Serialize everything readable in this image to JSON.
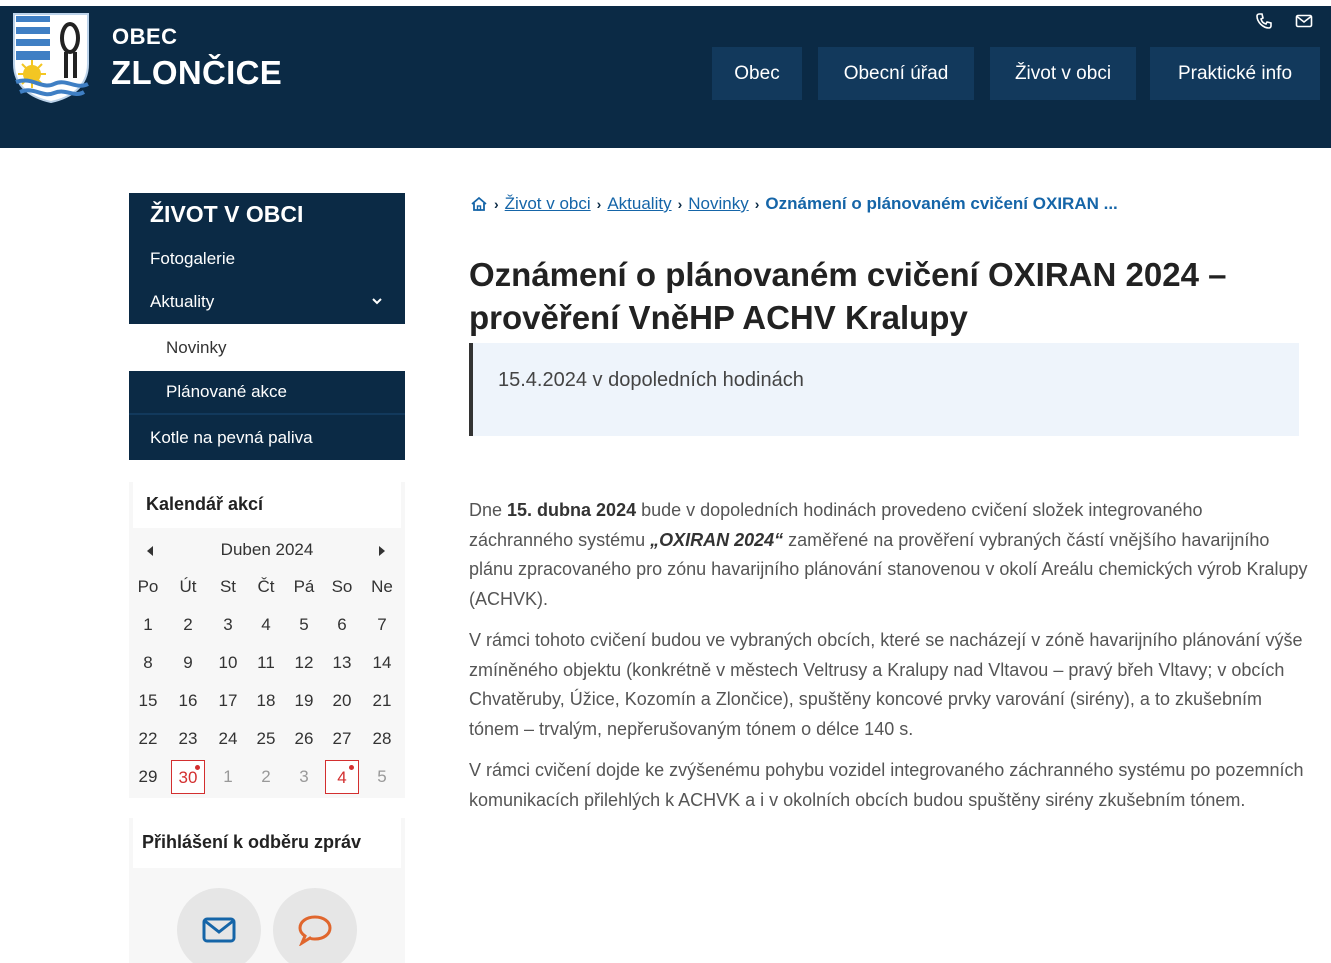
{
  "header": {
    "brand_small": "OBEC",
    "brand_big": "ZLONČICE",
    "nav": [
      "Obec",
      "Obecní úřad",
      "Život v obci",
      "Praktické info"
    ],
    "icons": [
      "phone-icon",
      "mail-icon"
    ]
  },
  "sidebar": {
    "heading": "ŽIVOT V OBCI",
    "items": [
      "Fotogalerie",
      "Aktuality",
      "Novinky",
      "Plánované akce",
      "Kotle na pevná paliva"
    ]
  },
  "calendar": {
    "title": "Kalendář akcí",
    "month": "Duben 2024",
    "weekdays": [
      "Po",
      "Út",
      "St",
      "Čt",
      "Pá",
      "So",
      "Ne"
    ],
    "weeks": [
      [
        "1",
        "2",
        "3",
        "4",
        "5",
        "6",
        "7"
      ],
      [
        "8",
        "9",
        "10",
        "11",
        "12",
        "13",
        "14"
      ],
      [
        "15",
        "16",
        "17",
        "18",
        "19",
        "20",
        "21"
      ],
      [
        "22",
        "23",
        "24",
        "25",
        "26",
        "27",
        "28"
      ],
      [
        "29",
        "30",
        "1",
        "2",
        "3",
        "4",
        "5"
      ]
    ],
    "event_days": [
      "30",
      "4"
    ]
  },
  "subscribe": {
    "title": "Přihlášení k odběru zpráv"
  },
  "breadcrumb": {
    "items": [
      "Život v obci",
      "Aktuality",
      "Novinky"
    ],
    "current": "Oznámení o plánovaném cvičení OXIRAN ..."
  },
  "article": {
    "title": "Oznámení o plánovaném cvičení OXIRAN 2024 – prověření VněHP ACHV Kralupy",
    "lead": "15.4.2024 v dopoledních hodinách",
    "p1_pre": "Dne ",
    "p1_bold": "15. dubna 2024",
    "p1_mid": " bude v dopoledních hodinách provedeno cvičení složek integrovaného záchranného systému ",
    "p1_em": "„OXIRAN 2024“",
    "p1_post": " zaměřené na prověření vybraných částí vnějšího havarijního plánu zpracovaného pro zónu havarijního plánování stanovenou v okolí Areálu chemických výrob Kralupy (ACHVK).",
    "p2": "V rámci tohoto cvičení budou ve vybraných obcích, které se nacházejí v zóně havarijního plánování výše zmíněného objektu (konkrétně v městech Veltrusy a Kralupy nad Vltavou – pravý břeh Vltavy; v obcích Chvatěruby, Úžice, Kozomín a Zlončice), spuštěny koncové prvky varování (sirény), a to zkušebním tónem – trvalým, nepřerušovaným tónem o délce 140 s.",
    "p3": "V rámci cvičení dojde ke zvýšenému pohybu vozidel integrovaného záchranného systému po pozemních komunikacích přilehlých k ACHVK a  i v okolních obcích budou spuštěny sirény zkušebním tónem."
  }
}
